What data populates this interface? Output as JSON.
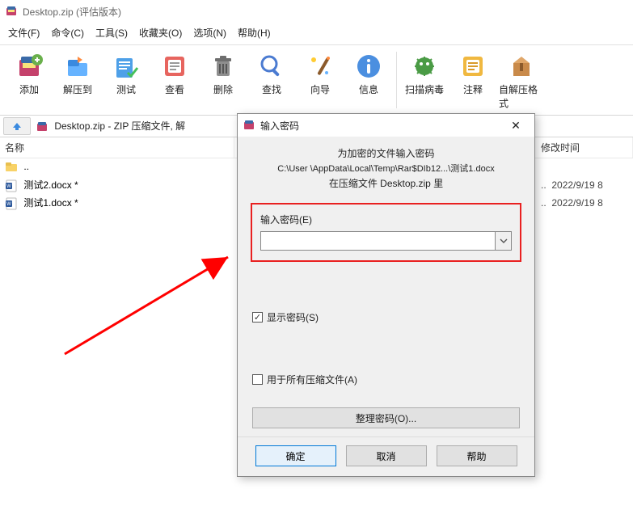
{
  "window": {
    "title": "Desktop.zip (评估版本)"
  },
  "menubar": {
    "items": [
      "文件(F)",
      "命令(C)",
      "工具(S)",
      "收藏夹(O)",
      "选项(N)",
      "帮助(H)"
    ]
  },
  "toolbar": {
    "items": [
      {
        "label": "添加",
        "icon": "add"
      },
      {
        "label": "解压到",
        "icon": "extract"
      },
      {
        "label": "测试",
        "icon": "test"
      },
      {
        "label": "查看",
        "icon": "view"
      },
      {
        "label": "删除",
        "icon": "delete"
      },
      {
        "label": "查找",
        "icon": "find"
      },
      {
        "label": "向导",
        "icon": "wizard"
      },
      {
        "label": "信息",
        "icon": "info"
      },
      {
        "label": "扫描病毒",
        "icon": "virus"
      },
      {
        "label": "注释",
        "icon": "comment"
      },
      {
        "label": "自解压格式",
        "icon": "sfx"
      }
    ]
  },
  "address": {
    "text": "Desktop.zip - ZIP 压缩文件, 解"
  },
  "list": {
    "headers": {
      "name": "名称",
      "date": "修改时间"
    },
    "updir": "..",
    "rows": [
      {
        "name": "测试2.docx *",
        "date": "2022/9/19 8"
      },
      {
        "name": "测试1.docx *",
        "date": "2022/9/19 8"
      }
    ]
  },
  "dialog": {
    "title": "输入密码",
    "hint": "为加密的文件输入密码",
    "path": "C:\\User            \\AppData\\Local\\Temp\\Rar$DIb12...\\测试1.docx",
    "inzip": "在压缩文件 Desktop.zip 里",
    "pwlabel": "输入密码(E)",
    "pwvalue": "",
    "show_pw": {
      "label": "显示密码(S)",
      "checked": true
    },
    "use_all": {
      "label": "用于所有压缩文件(A)",
      "checked": false
    },
    "organize": "整理密码(O)...",
    "ok": "确定",
    "cancel": "取消",
    "help": "帮助"
  }
}
